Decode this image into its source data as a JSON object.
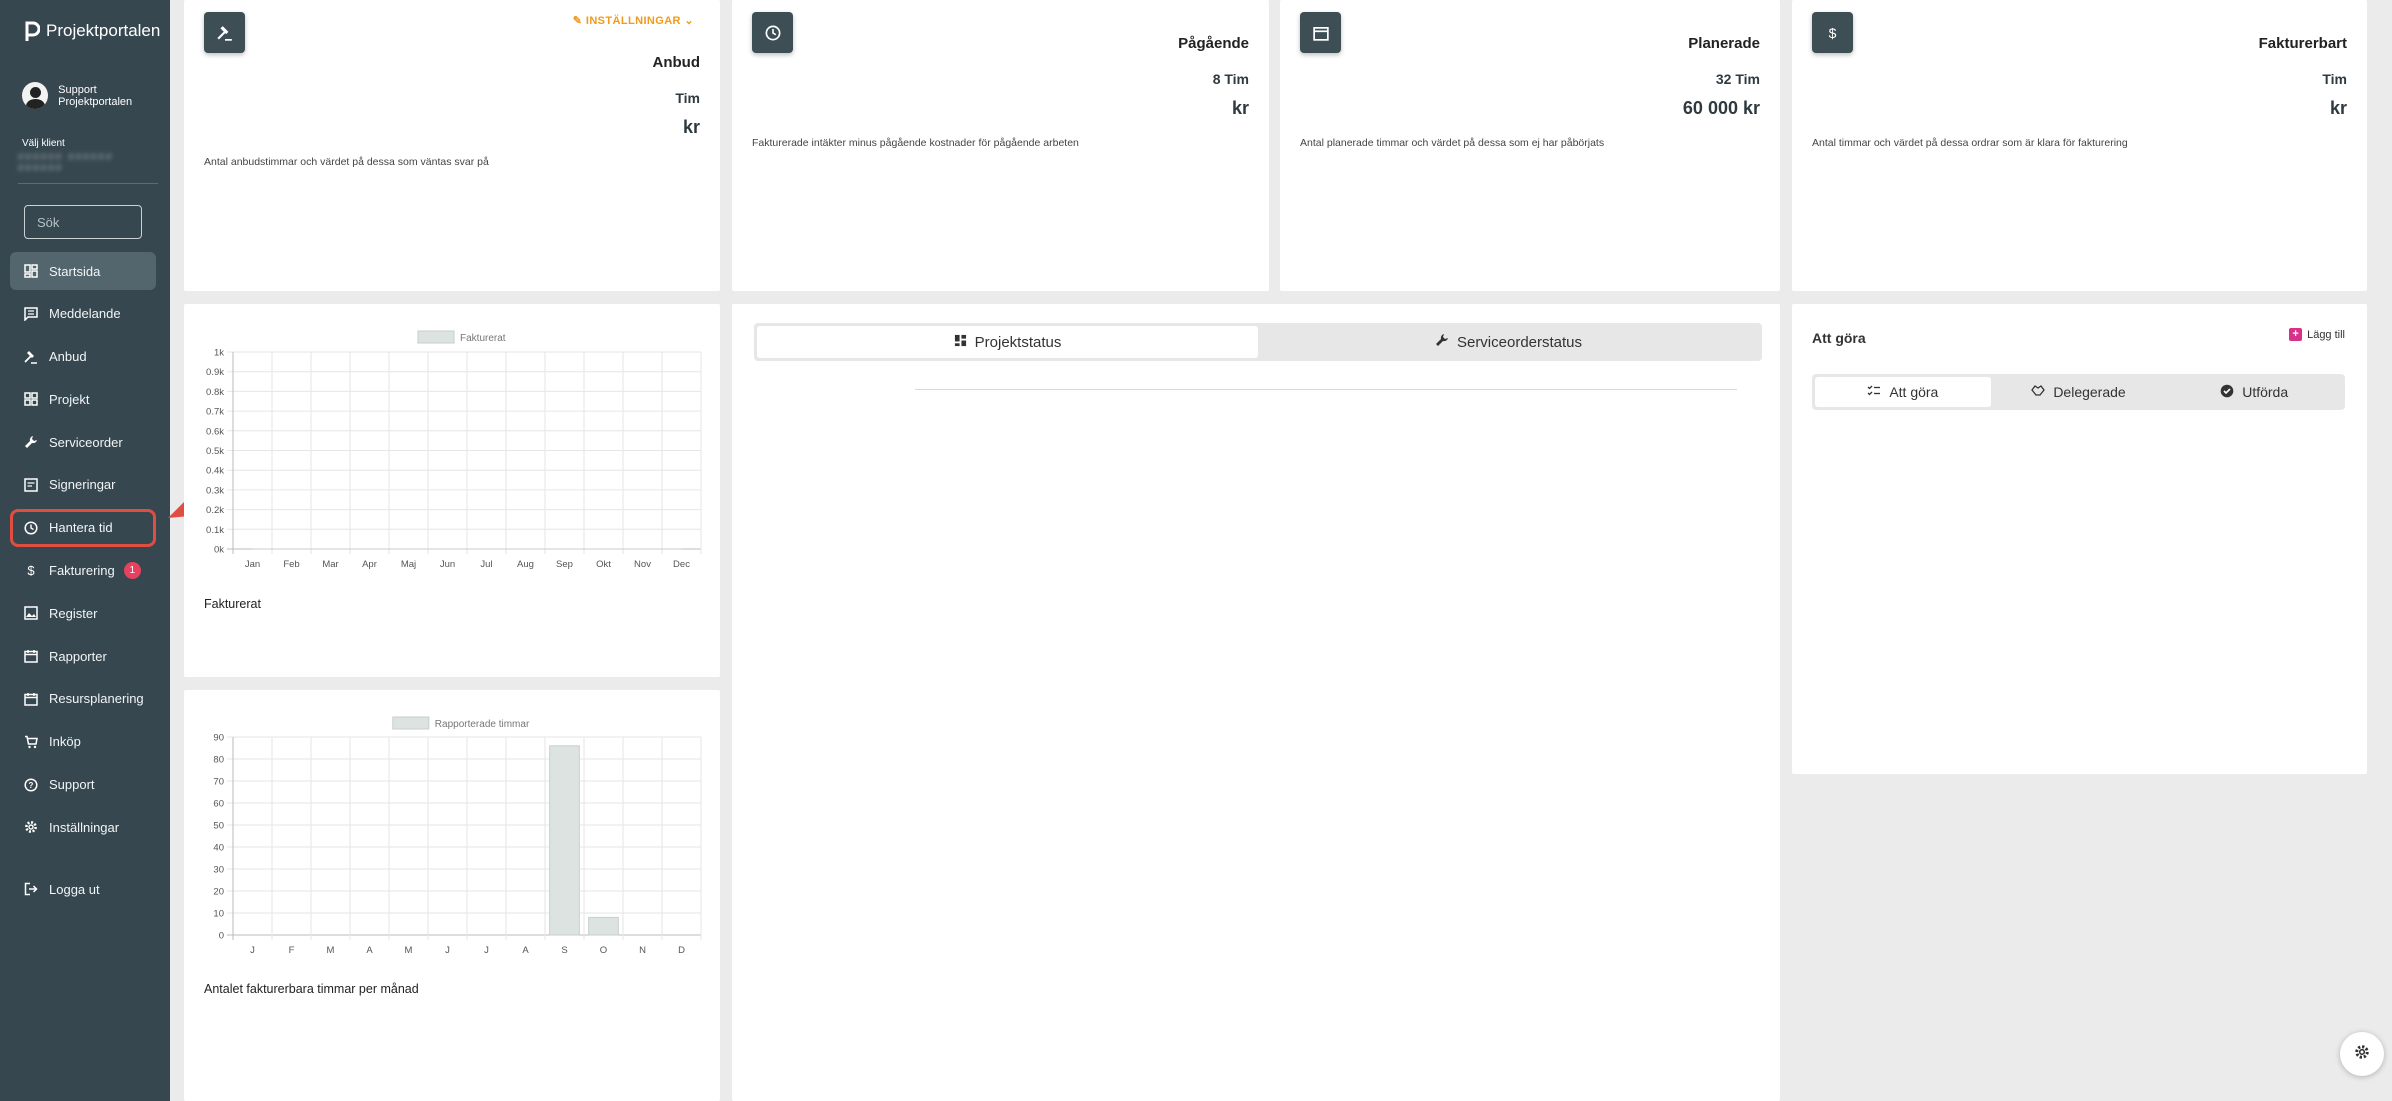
{
  "app": {
    "title": "Projektportalen"
  },
  "user": {
    "name": "Support Projektportalen"
  },
  "client": {
    "label": "Välj klient",
    "value": "######  ######  ######"
  },
  "search": {
    "placeholder": "Sök"
  },
  "sidebar": {
    "items": [
      {
        "label": "Startsida",
        "icon": "dashboard-icon"
      },
      {
        "label": "Meddelande",
        "icon": "message-icon"
      },
      {
        "label": "Anbud",
        "icon": "gavel-icon"
      },
      {
        "label": "Projekt",
        "icon": "grid-icon"
      },
      {
        "label": "Serviceorder",
        "icon": "wrench-icon"
      },
      {
        "label": "Signeringar",
        "icon": "signature-icon"
      },
      {
        "label": "Hantera tid",
        "icon": "clock-icon"
      },
      {
        "label": "Fakturering",
        "icon": "dollar-icon",
        "badge": "1"
      },
      {
        "label": "Register",
        "icon": "image-icon"
      },
      {
        "label": "Rapporter",
        "icon": "calendar-icon"
      },
      {
        "label": "Resursplanering",
        "icon": "calendar-icon"
      },
      {
        "label": "Inköp",
        "icon": "cart-icon"
      },
      {
        "label": "Support",
        "icon": "help-icon"
      },
      {
        "label": "Inställningar",
        "icon": "gear-icon"
      }
    ],
    "logout": {
      "label": "Logga ut",
      "icon": "logout-icon"
    }
  },
  "kpis": {
    "anbud": {
      "settings": "INSTÄLLNINGAR",
      "title": "Anbud",
      "hours": "Tim",
      "money": "kr",
      "desc": "Antal anbudstimmar och värdet på dessa som väntas svar på"
    },
    "pagaende": {
      "title": "Pågående",
      "hours": "8 Tim",
      "money": "kr",
      "desc": "Fakturerade intäkter minus pågående kostnader för pågående arbeten"
    },
    "planerade": {
      "title": "Planerade",
      "hours": "32 Tim",
      "money": "60 000 kr",
      "desc": "Antal planerade timmar och värdet på dessa som ej har påbörjats"
    },
    "fakturerbart": {
      "title": "Fakturerbart",
      "hours": "Tim",
      "money": "kr",
      "desc": "Antal timmar och värdet på dessa ordrar som är klara för fakturering"
    }
  },
  "charts": {
    "invoiced_caption": "Fakturerat",
    "hours_caption": "Antalet fakturerbara timmar per månad"
  },
  "status_tabs": {
    "project": "Projektstatus",
    "service": "Serviceorderstatus"
  },
  "todo": {
    "title": "Att göra",
    "add": "Lägg till",
    "tabs": [
      "Att göra",
      "Delegerade",
      "Utförda"
    ]
  },
  "colors": {
    "sidebar": "#36474f",
    "accent": "#f29a1a",
    "highlight": "#e04e42",
    "badge": "#e8415f",
    "bar": "#dde3e1"
  },
  "chart_data": [
    {
      "type": "line",
      "legend": "Fakturerat",
      "categories": [
        "Jan",
        "Feb",
        "Mar",
        "Apr",
        "Maj",
        "Jun",
        "Jul",
        "Aug",
        "Sep",
        "Okt",
        "Nov",
        "Dec"
      ],
      "series": [
        {
          "name": "Fakturerat",
          "values": [
            0,
            0,
            0,
            0,
            0,
            0,
            0,
            0,
            0,
            0,
            0,
            0
          ]
        }
      ],
      "yticks": [
        "0k",
        "0.1k",
        "0.2k",
        "0.3k",
        "0.4k",
        "0.5k",
        "0.6k",
        "0.7k",
        "0.8k",
        "0.9k",
        "1k"
      ],
      "ylim": [
        0,
        1000
      ],
      "grid": true,
      "legend_position": "top"
    },
    {
      "type": "bar",
      "legend": "Rapporterade timmar",
      "categories": [
        "J",
        "F",
        "M",
        "A",
        "M",
        "J",
        "J",
        "A",
        "S",
        "O",
        "N",
        "D"
      ],
      "series": [
        {
          "name": "Rapporterade timmar",
          "values": [
            0,
            0,
            0,
            0,
            0,
            0,
            0,
            0,
            86,
            8,
            0,
            0
          ]
        }
      ],
      "yticks": [
        "0",
        "10",
        "20",
        "30",
        "40",
        "50",
        "60",
        "70",
        "80",
        "90"
      ],
      "ylim": [
        0,
        90
      ],
      "grid": true,
      "legend_position": "top"
    }
  ]
}
